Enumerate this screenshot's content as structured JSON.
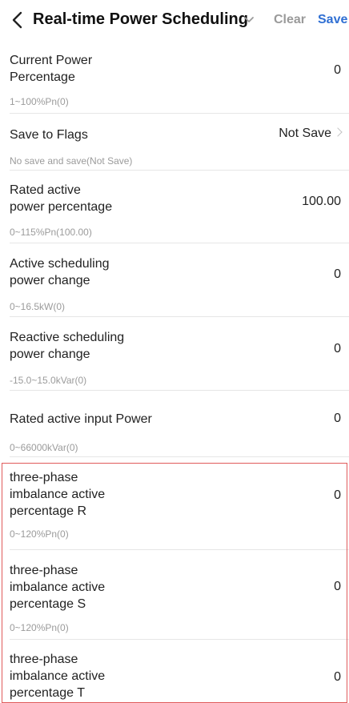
{
  "header": {
    "title": "Real-time Power Scheduling",
    "clear_label": "Clear",
    "save_label": "Save",
    "back_icon": "chevron-left-icon",
    "title_icon": "chevron-down-icon"
  },
  "colors": {
    "accent": "#2f6fd3",
    "muted": "#9a9a9a",
    "highlight_border": "#e05a5a"
  },
  "rows": [
    {
      "label": "Current Power\nPercentage",
      "value": "0",
      "hint": "1~100%Pn(0)"
    },
    {
      "label": "Save to Flags",
      "value": "Not Save",
      "hint": "No save and save(Not Save)"
    },
    {
      "label": "Rated active\npower percentage",
      "value": "100.00",
      "hint": "0~115%Pn(100.00)"
    },
    {
      "label": "Active scheduling\npower change",
      "value": "0",
      "hint": "0~16.5kW(0)"
    },
    {
      "label": "Reactive scheduling\npower change",
      "value": "0",
      "hint": "-15.0~15.0kVar(0)"
    },
    {
      "label": "Rated active input Power",
      "value": "0",
      "hint": "0~66000kVar(0)"
    },
    {
      "label": "three-phase\nimbalance active\npercentage R",
      "value": "0",
      "hint": "0~120%Pn(0)"
    },
    {
      "label": "three-phase\nimbalance active\npercentage S",
      "value": "0",
      "hint": "0~120%Pn(0)"
    },
    {
      "label": "three-phase\nimbalance active\npercentage T",
      "value": "0",
      "hint": ""
    }
  ]
}
